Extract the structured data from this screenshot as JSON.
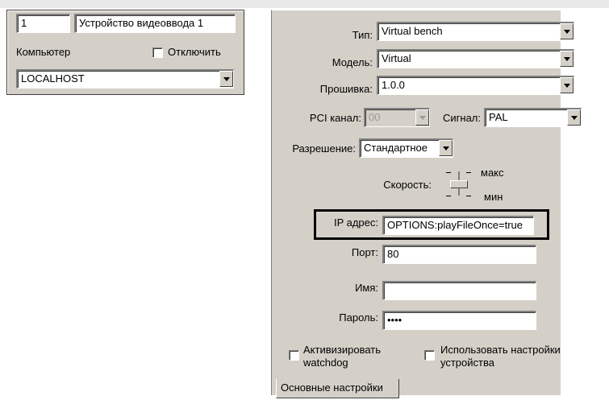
{
  "left_panel": {
    "number_value": "1",
    "device_name_value": "Устройство видеоввода 1",
    "computer_label": "Компьютер",
    "disable_label": "Отключить",
    "computer_value": "LOCALHOST"
  },
  "right_panel": {
    "type_label": "Тип:",
    "type_value": "Virtual bench",
    "model_label": "Модель:",
    "model_value": "Virtual",
    "firmware_label": "Прошивка:",
    "firmware_value": "1.0.0",
    "pci_label": "PCI канал:",
    "pci_value": "00",
    "signal_label": "Сигнал:",
    "signal_value": "PAL",
    "resolution_label": "Разрешение:",
    "resolution_value": "Стандартное",
    "speed_label": "Скорость:",
    "speed_max_label": "макс",
    "speed_min_label": "мин",
    "ip_label": "IP адрес:",
    "ip_value": "OPTIONS:playFileOnce=true",
    "port_label": "Порт:",
    "port_value": "80",
    "name_label": "Имя:",
    "name_value": "",
    "password_label": "Пароль:",
    "password_value": "••••",
    "watchdog_label_line1": "Активизировать",
    "watchdog_label_line2": "watchdog",
    "device_settings_label_line1": "Использовать настройки",
    "device_settings_label_line2": "устройства",
    "tab_label": "Основные настройки"
  }
}
